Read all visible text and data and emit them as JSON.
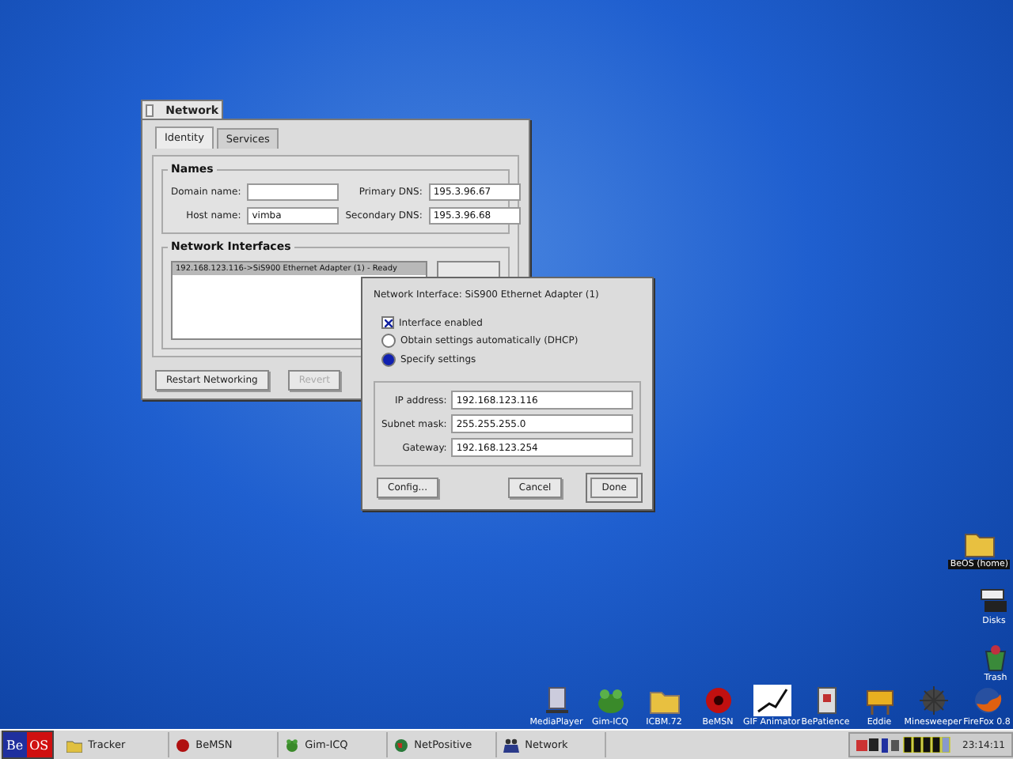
{
  "network_window": {
    "title": "Network",
    "tabs": [
      {
        "label": "Identity",
        "selected": true
      },
      {
        "label": "Services",
        "selected": false
      }
    ],
    "names": {
      "title": "Names",
      "fields": [
        {
          "label": "Domain name:"
        },
        {
          "label": "Primary DNS:",
          "value": "195.3.96.67"
        },
        {
          "label": "Host name:",
          "value": "vimba"
        },
        {
          "label": "Secondary DNS:",
          "value": "195.3.96.68"
        }
      ]
    },
    "interfaces": {
      "title": "Network Interfaces",
      "items": [
        {
          "text": "192.168.123.116->SiS900 Ethernet Adapter (1) - Ready",
          "selected": true
        }
      ]
    },
    "buttons": [
      {
        "label": "Restart Networking",
        "disabled": false
      },
      {
        "label": "Revert",
        "disabled": true
      }
    ]
  },
  "interface_dialog": {
    "heading": "Network Interface:  SiS900 Ethernet Adapter (1)",
    "options": [
      {
        "kind": "checkbox",
        "label": "Interface enabled",
        "checked": true
      },
      {
        "kind": "radio",
        "label": "Obtain settings automatically (DHCP)",
        "checked": false
      },
      {
        "kind": "radio",
        "label": "Specify settings",
        "checked": true
      }
    ],
    "fields": [
      {
        "label": "IP address:",
        "value": "192.168.123.116"
      },
      {
        "label": "Subnet mask:",
        "value": "255.255.255.0"
      },
      {
        "label": "Gateway:",
        "value": "192.168.123.254"
      }
    ],
    "buttons": [
      {
        "label": "Config...",
        "default": false
      },
      {
        "label": "Cancel",
        "default": false
      },
      {
        "label": "Done",
        "default": true
      }
    ]
  },
  "desktop_icons": [
    {
      "label": "BeOS (home)",
      "selected": true
    },
    {
      "label": "Disks",
      "selected": false
    },
    {
      "label": "Trash",
      "selected": false
    }
  ],
  "dock_icons": [
    "MediaPlayer",
    "Gim-ICQ",
    "ICBM.72",
    "BeMSN",
    "GIF Animator",
    "BePatience",
    "Eddie",
    "Minesweeper",
    "FireFox 0.8"
  ],
  "taskbar": {
    "logo": [
      "Be",
      "OS"
    ],
    "items": [
      {
        "label": "Tracker"
      },
      {
        "label": "BeMSN"
      },
      {
        "label": "Gim-ICQ"
      },
      {
        "label": "NetPositive"
      },
      {
        "label": "Network"
      }
    ],
    "clock": "23:14:11"
  }
}
